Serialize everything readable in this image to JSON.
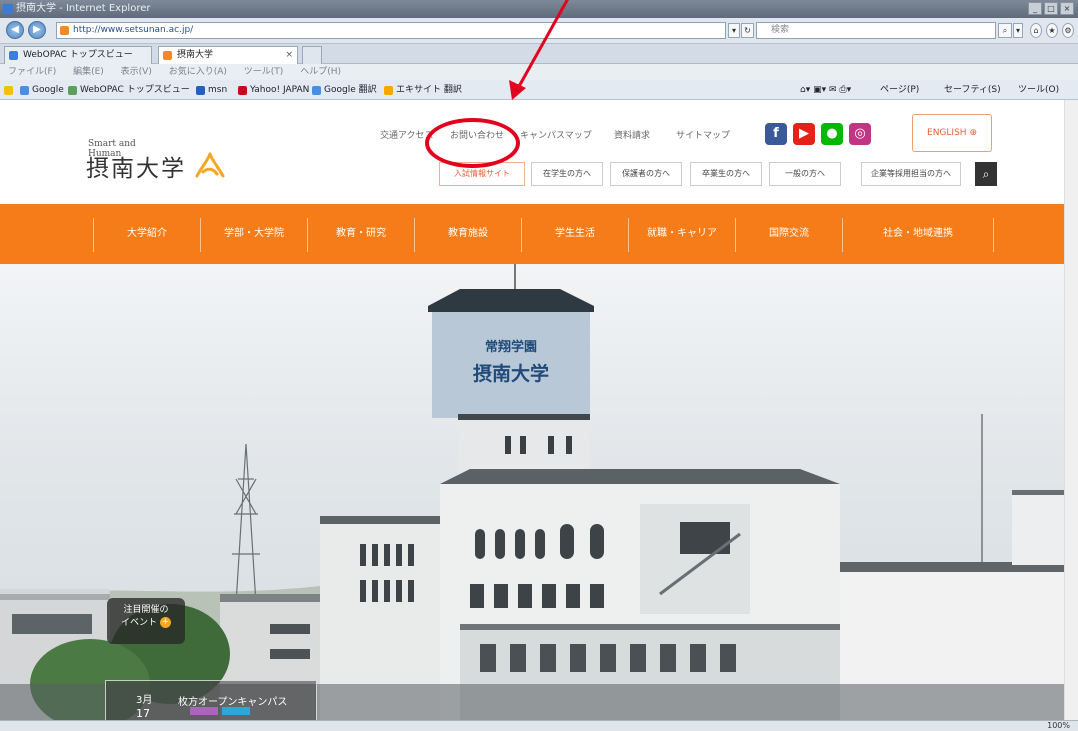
{
  "browser": {
    "window_title": "摂南大学 - Internet Explorer",
    "address": "http://www.setsunan.ac.jp/",
    "search_placeholder": "検索",
    "tabs": [
      {
        "label": "WebOPAC トップスビュー",
        "active": false
      },
      {
        "label": "摂南大学",
        "active": true
      }
    ],
    "menu": [
      "ファイル(F)",
      "編集(E)",
      "表示(V)",
      "お気に入り(A)",
      "ツール(T)",
      "ヘルプ(H)"
    ],
    "favorites": [
      "Google",
      "WebOPAC トップスビュー",
      "msn",
      "Yahoo! JAPAN",
      "Google 翻訳",
      "エキサイト 翻訳"
    ],
    "commands": [
      "ページ(P)",
      "セーフティ(S)",
      "ツール(O)"
    ],
    "zoom": "100%"
  },
  "site": {
    "logo_tagline": "Smart and Human",
    "logo_name": "摂南大学",
    "brand_color": "#f57c18",
    "util_links": [
      "交通アクセス",
      "お問い合わせ",
      "キャンパスマップ",
      "資料請求",
      "サイトマップ"
    ],
    "sns": [
      "facebook-icon",
      "youtube-icon",
      "line-icon",
      "instagram-icon"
    ],
    "english_label": "ENGLISH",
    "audience_links": [
      "入試情報サイト",
      "在学生の方へ",
      "保護者の方へ",
      "卒業生の方へ",
      "一般の方へ",
      "企業等採用担当の方へ"
    ],
    "nav": [
      "大学紹介",
      "学部・大学院",
      "教育・研究",
      "教育施設",
      "学生生活",
      "就職・キャリア",
      "国際交流",
      "社会・地域連携"
    ],
    "building_sign": [
      "常翔学園",
      "摂南大学"
    ],
    "event_bubble": {
      "line1": "注目開催の",
      "line2": "イベント"
    },
    "event_card": {
      "month": "3月",
      "day": "17",
      "title": "枚方オープンキャンパス"
    }
  }
}
